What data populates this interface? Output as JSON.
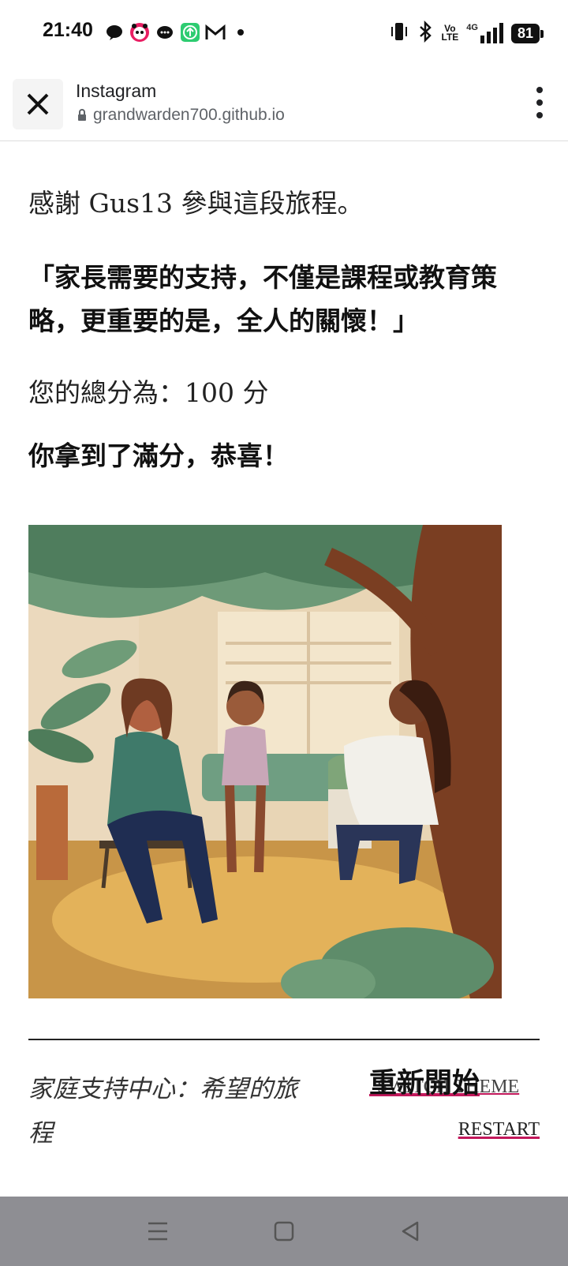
{
  "status_bar": {
    "time": "21:40",
    "network": "4G",
    "volte_top": "Vo",
    "volte_bottom": "LTE",
    "battery": "81",
    "notification_icons": [
      "chat-icon",
      "panda-icon",
      "chat-bubble-icon",
      "cloud-icon",
      "upload-icon",
      "mail-icon",
      "dot-icon"
    ]
  },
  "browser": {
    "title": "Instagram",
    "url": "grandwarden700.github.io"
  },
  "main": {
    "thanks": "感謝 Gus13 參與這段旅程。",
    "quote": "「家長需要的支持，不僅是課程或教育策略，更重要的是，全人的關懷！」",
    "score": "您的總分為：100 分",
    "congrats": "你拿到了滿分，恭喜！"
  },
  "footer": {
    "site_title": "家庭支持中心：希望的旅程",
    "restart_cn": "重新開始",
    "switch_theme": "SWITCH THEME",
    "restart_en": "RESTART"
  },
  "colors": {
    "accent_underline": "#c2185b",
    "navbar": "#8e8e93"
  }
}
